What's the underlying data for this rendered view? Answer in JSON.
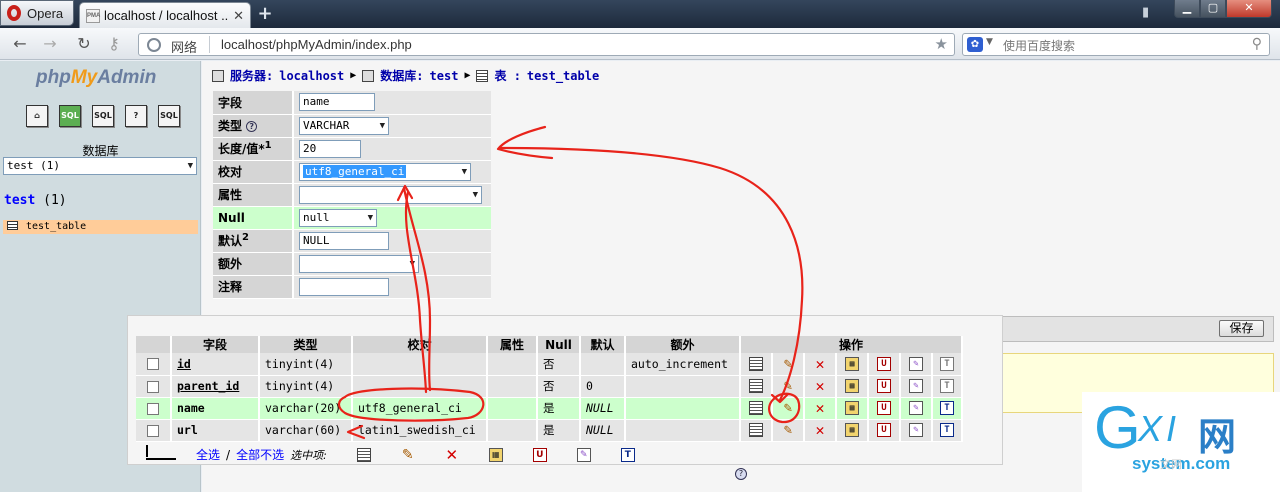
{
  "browser": {
    "opera_label": "Opera",
    "tab_title": "localhost / localhost ...",
    "tab_favicon_text": "PMA",
    "address_prefix": "网络",
    "url": "localhost/phpMyAdmin/index.php",
    "search_placeholder": "使用百度搜索"
  },
  "sidebar": {
    "logo_php": "php",
    "logo_my": "My",
    "logo_admin": "Admin",
    "icons": [
      "home-icon",
      "sql-query-icon",
      "sql-icon",
      "help-icon",
      "docs-icon"
    ],
    "icon_labels": [
      "⌂",
      "SQL",
      "SQL",
      "?",
      "SQL"
    ],
    "db_label": "数据库",
    "db_select": "test (1)",
    "db_name": "test",
    "db_count": "(1)",
    "table_name": "test_table"
  },
  "breadcrumb": {
    "server_label": "服务器:",
    "server": "localhost",
    "db_label": "数据库:",
    "db": "test",
    "table_label": "表 :",
    "table": "test_table"
  },
  "field_form": {
    "labels": {
      "field": "字段",
      "type": "类型",
      "length": "长度/值*",
      "length_sup": "1",
      "collation": "校对",
      "attributes": "属性",
      "null": "Null",
      "default": "默认",
      "default_sup": "2",
      "extra": "额外",
      "comment": "注释"
    },
    "values": {
      "field": "name",
      "type": "VARCHAR",
      "length": "20",
      "collation": "utf8_general_ci",
      "attributes": "",
      "null": "null",
      "default": "NULL",
      "extra": "",
      "comment": ""
    },
    "save_button": "保存"
  },
  "structure": {
    "headers": [
      "字段",
      "类型",
      "校对",
      "属性",
      "Null",
      "默认",
      "额外",
      "操作"
    ],
    "rows": [
      {
        "field": "id",
        "type": "tinyint(4)",
        "collation": "",
        "attributes": "",
        "null": "否",
        "default": "",
        "extra": "auto_increment"
      },
      {
        "field": "parent_id",
        "type": "tinyint(4)",
        "collation": "",
        "attributes": "",
        "null": "否",
        "default": "0",
        "extra": ""
      },
      {
        "field": "name",
        "type": "varchar(20)",
        "collation": "utf8_general_ci",
        "attributes": "",
        "null": "是",
        "default": "NULL",
        "extra": ""
      },
      {
        "field": "url",
        "type": "varchar(60)",
        "collation": "latin1_swedish_ci",
        "attributes": "",
        "null": "是",
        "default": "NULL",
        "extra": ""
      }
    ],
    "check_all": "全选",
    "separator": "/",
    "uncheck_all": "全部不选",
    "with_selected": "选中项:"
  },
  "watermark": {
    "g": "G",
    "xi": "XI",
    "wang": "网",
    "domain": "system.com",
    "faint": "文网"
  },
  "colors": {
    "annotation": "#e8231a",
    "highlight_row": "#ccffcc",
    "selected_table": "#ffcc99"
  }
}
